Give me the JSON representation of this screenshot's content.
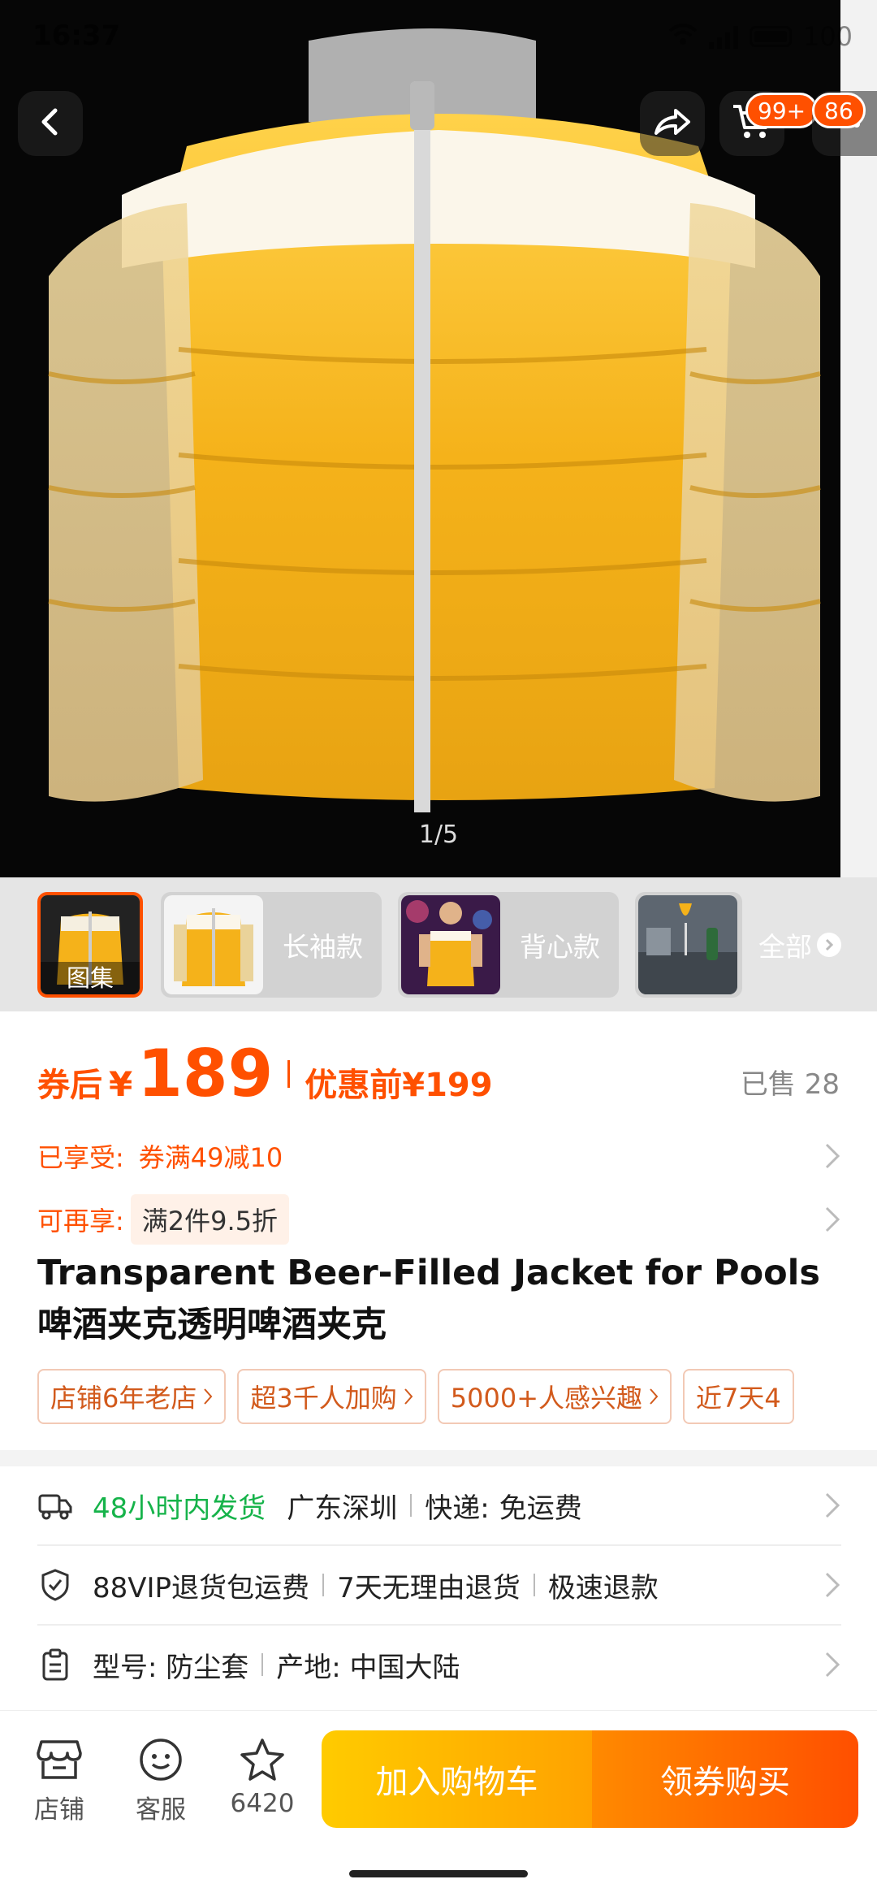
{
  "status_bar": {
    "time": "16:37",
    "battery": "100"
  },
  "hero": {
    "pager": "1/5",
    "cart_badge": "99+",
    "msg_badge": "86"
  },
  "variants": {
    "gallery_label": "图集",
    "items": [
      {
        "label": "长袖款"
      },
      {
        "label": "背心款"
      }
    ],
    "all_label": "全部"
  },
  "price": {
    "prefix": "券后",
    "currency": "¥",
    "value": "189",
    "original": "优惠前¥199",
    "sold": "已售 28"
  },
  "promos": [
    {
      "label": "已享受:",
      "value": "券满49减10"
    },
    {
      "label": "可再享:",
      "value": "满2件9.5折"
    }
  ],
  "title": "Transparent Beer-Filled Jacket for Pools啤酒夹克透明啤酒夹克",
  "tags": [
    "店铺6年老店",
    "超3千人加购",
    "5000+人感兴趣",
    "近7天4"
  ],
  "service": {
    "shipping_time": "48小时内发货",
    "origin": "广东深圳",
    "express_label": "快递:",
    "express_value": "免运费",
    "guarantee_1": "88VIP退货包运费",
    "guarantee_2": "7天无理由退货",
    "guarantee_3": "极速退款",
    "model": "型号: 防尘套",
    "place": "产地: 中国大陆"
  },
  "bottom": {
    "shop": "店铺",
    "service": "客服",
    "favorites": "6420",
    "add_cart": "加入购物车",
    "buy": "领券购买"
  },
  "colors": {
    "accent": "#ff5000",
    "cart_gradient": "#ffa200",
    "green": "#16b34a"
  }
}
